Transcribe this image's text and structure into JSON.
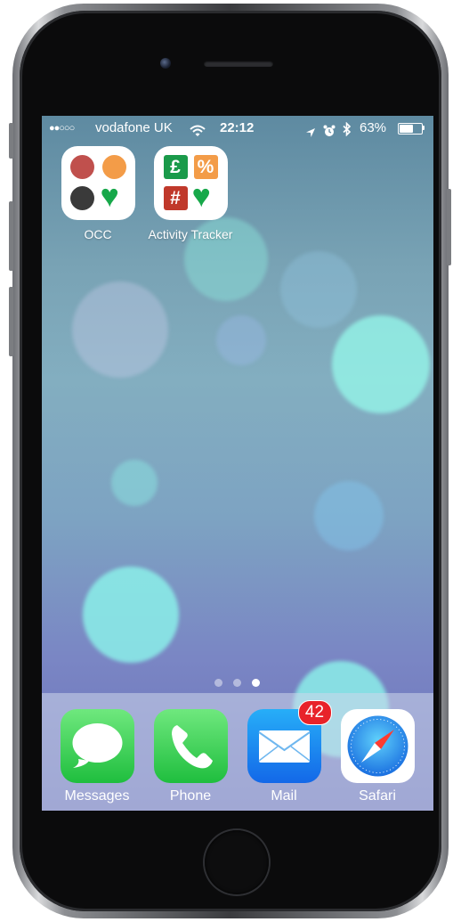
{
  "status_bar": {
    "signal": "●●○○○",
    "carrier": "vodafone UK",
    "time": "22:12",
    "battery_percent": "63%",
    "battery_level": 0.63,
    "icons": [
      "wifi-icon",
      "location-arrow-icon",
      "alarm-clock-icon",
      "bluetooth-icon",
      "battery-icon"
    ]
  },
  "home_apps": [
    {
      "label": "OCC",
      "icon": "occ-icon"
    },
    {
      "label": "Activity Tracker",
      "icon": "activity-tracker-icon"
    }
  ],
  "activity_tracker_glyphs": {
    "pound": "£",
    "percent": "%",
    "hash": "#",
    "heart": "♥"
  },
  "occ_heart": "♥",
  "page_indicator": {
    "pages": 3,
    "current": 3
  },
  "dock": [
    {
      "label": "Messages",
      "icon": "messages-icon"
    },
    {
      "label": "Phone",
      "icon": "phone-icon"
    },
    {
      "label": "Mail",
      "icon": "mail-icon",
      "badge": "42"
    },
    {
      "label": "Safari",
      "icon": "safari-icon"
    }
  ],
  "colors": {
    "messages_green": "#4cd964",
    "phone_green": "#4cd964",
    "mail_blue": "#1e88e5",
    "badge_red": "#e8232a",
    "occ_red": "#c0504d",
    "occ_orange": "#f39c48",
    "occ_dark": "#3a3a3a",
    "tracker_green": "#1a9a4a",
    "heart_green": "#17a84a",
    "tracker_orange": "#f39c48",
    "tracker_red": "#c0392b"
  }
}
